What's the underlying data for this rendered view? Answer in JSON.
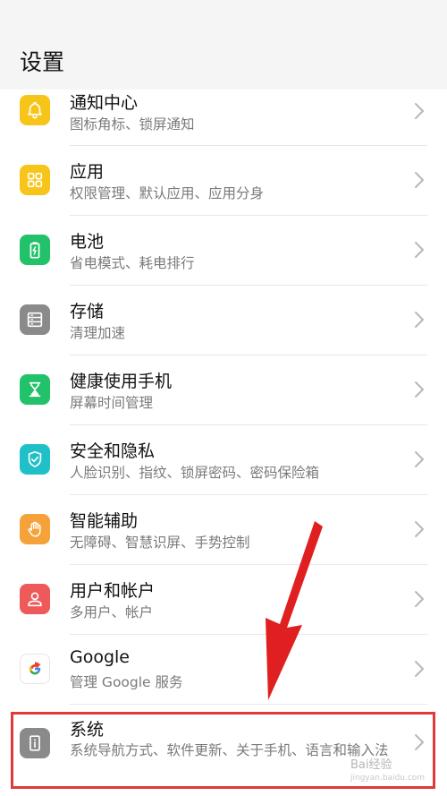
{
  "header": {
    "title": "设置"
  },
  "items": [
    {
      "id": "notifications",
      "label": "通知中心",
      "sub": "图标角标、锁屏通知",
      "color": "#F7C51A",
      "icon": "bell-icon"
    },
    {
      "id": "apps",
      "label": "应用",
      "sub": "权限管理、默认应用、应用分身",
      "color": "#F7C51A",
      "icon": "apps-grid-icon"
    },
    {
      "id": "battery",
      "label": "电池",
      "sub": "省电模式、耗电排行",
      "color": "#22C26B",
      "icon": "battery-icon"
    },
    {
      "id": "storage",
      "label": "存储",
      "sub": "清理加速",
      "color": "#8A8A8A",
      "icon": "storage-icon"
    },
    {
      "id": "digital-balance",
      "label": "健康使用手机",
      "sub": "屏幕时间管理",
      "color": "#22C26B",
      "icon": "hourglass-icon"
    },
    {
      "id": "security",
      "label": "安全和隐私",
      "sub": "人脸识别、指纹、锁屏密码、密码保险箱",
      "color": "#1FC0C8",
      "icon": "shield-icon"
    },
    {
      "id": "assistance",
      "label": "智能辅助",
      "sub": "无障碍、智慧识屏、手势控制",
      "color": "#F6A23A",
      "icon": "hand-icon"
    },
    {
      "id": "users",
      "label": "用户和帐户",
      "sub": "多用户、帐户",
      "color": "#EE5A5A",
      "icon": "user-icon"
    },
    {
      "id": "google",
      "label": "Google",
      "sub": "管理 Google 服务",
      "color": "#FFFFFF",
      "icon": "google-icon"
    },
    {
      "id": "system",
      "label": "系统",
      "sub": "系统导航方式、软件更新、关于手机、语言和输入法",
      "color": "#8A8A8A",
      "icon": "info-icon"
    }
  ],
  "watermark": {
    "text": "Bai经验",
    "url": "jingyan.baidu.com"
  },
  "colors": {
    "highlight": "#e03a3a",
    "arrow": "#e02020"
  }
}
